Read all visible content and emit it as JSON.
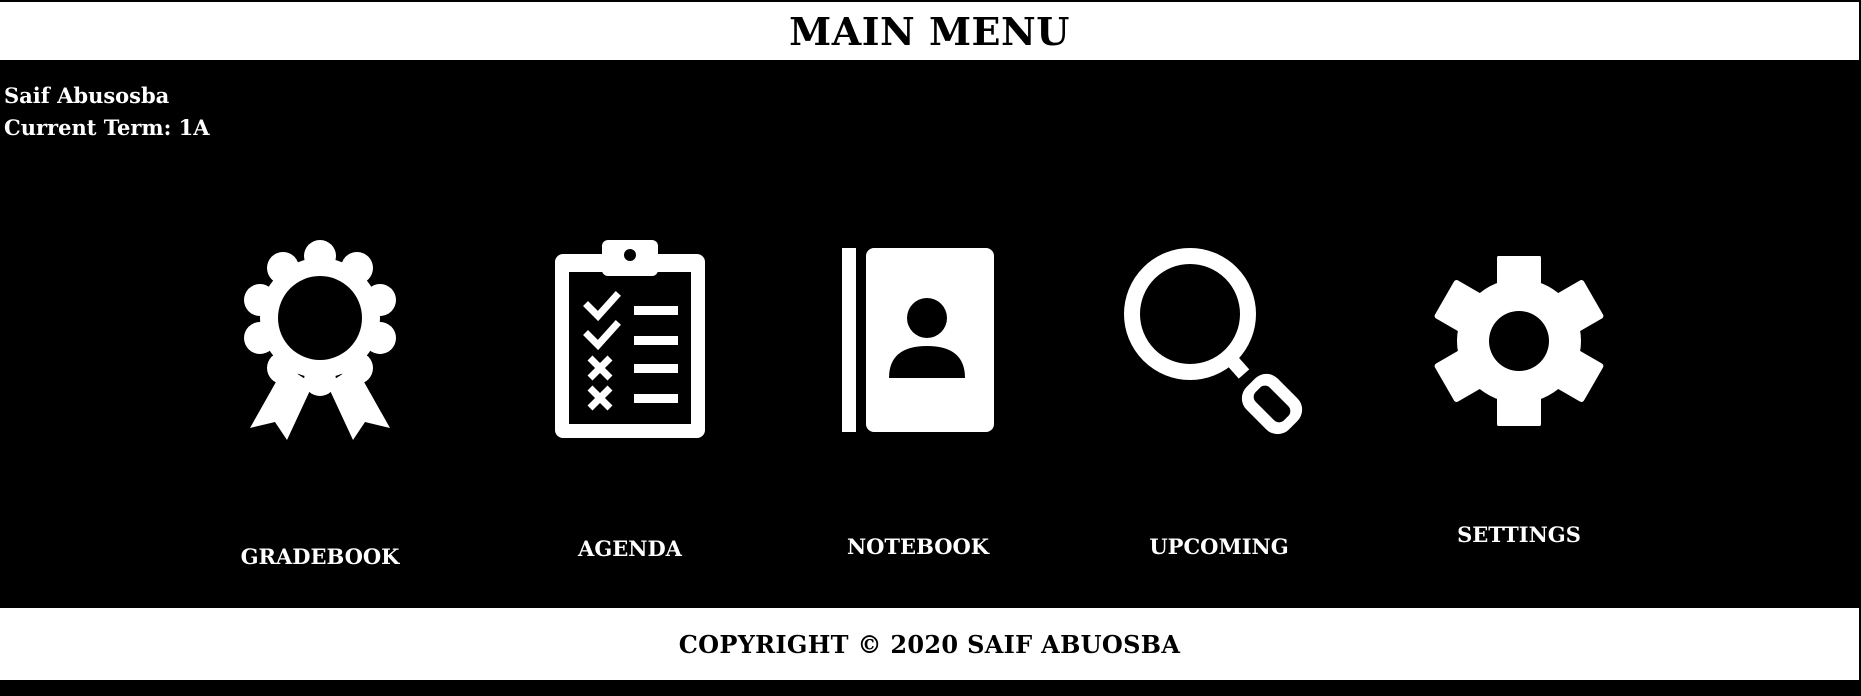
{
  "header": {
    "title": "MAIN MENU"
  },
  "user": {
    "name": "Saif Abusosba",
    "term": "Current Term: 1A"
  },
  "menu": {
    "items": [
      {
        "label": "GRADEBOOK",
        "icon": "award-ribbon-icon"
      },
      {
        "label": "AGENDA",
        "icon": "clipboard-checklist-icon"
      },
      {
        "label": "NOTEBOOK",
        "icon": "contact-book-icon"
      },
      {
        "label": "UPCOMING",
        "icon": "magnifier-icon"
      },
      {
        "label": "SETTINGS",
        "icon": "gear-icon"
      }
    ]
  },
  "footer": {
    "copyright": "COPYRIGHT © 2020 SAIF ABUOSBA"
  },
  "colors": {
    "background": "#000000",
    "foreground": "#ffffff",
    "header_bg": "#ffffff",
    "header_text": "#000000"
  }
}
